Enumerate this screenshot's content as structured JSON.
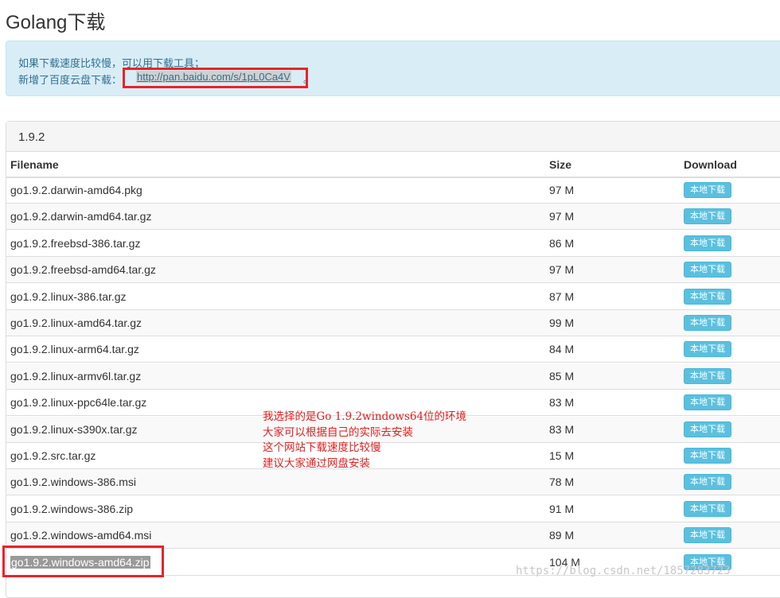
{
  "page_title": "Golang下载",
  "info": {
    "line1": "如果下载速度比较慢，可以用下载工具；",
    "line2_prefix": "新增了百度云盘下载：",
    "link": "http://pan.baidu.com/s/1pL0Ca4V",
    "link_suffix": "。"
  },
  "panel": {
    "version": "1.9.2",
    "columns": {
      "filename": "Filename",
      "size": "Size",
      "download": "Download"
    },
    "download_label": "本地下载",
    "rows": [
      {
        "name": "go1.9.2.darwin-amd64.pkg",
        "size": "97 M"
      },
      {
        "name": "go1.9.2.darwin-amd64.tar.gz",
        "size": "97 M"
      },
      {
        "name": "go1.9.2.freebsd-386.tar.gz",
        "size": "86 M"
      },
      {
        "name": "go1.9.2.freebsd-amd64.tar.gz",
        "size": "97 M"
      },
      {
        "name": "go1.9.2.linux-386.tar.gz",
        "size": "87 M"
      },
      {
        "name": "go1.9.2.linux-amd64.tar.gz",
        "size": "99 M"
      },
      {
        "name": "go1.9.2.linux-arm64.tar.gz",
        "size": "84 M"
      },
      {
        "name": "go1.9.2.linux-armv6l.tar.gz",
        "size": "85 M"
      },
      {
        "name": "go1.9.2.linux-ppc64le.tar.gz",
        "size": "83 M"
      },
      {
        "name": "go1.9.2.linux-s390x.tar.gz",
        "size": "83 M"
      },
      {
        "name": "go1.9.2.src.tar.gz",
        "size": "15 M"
      },
      {
        "name": "go1.9.2.windows-386.msi",
        "size": "78 M"
      },
      {
        "name": "go1.9.2.windows-386.zip",
        "size": "91 M"
      },
      {
        "name": "go1.9.2.windows-amd64.msi",
        "size": "89 M"
      },
      {
        "name": "go1.9.2.windows-amd64.zip",
        "size": "104 M"
      }
    ]
  },
  "annotation": {
    "lines": [
      "我选择的是Go 1.9.2windows64位的环境",
      "大家可以根据自己的实际去安装",
      "这个网站下载速度比较慢",
      "建议大家通过网盘安装"
    ]
  },
  "watermark": "https://blog.csdn.net/1857283723",
  "colors": {
    "accent_info_bg": "#d9edf7",
    "button": "#5bc0de",
    "highlight_box": "#e8242a",
    "annotation": "#e02020"
  }
}
